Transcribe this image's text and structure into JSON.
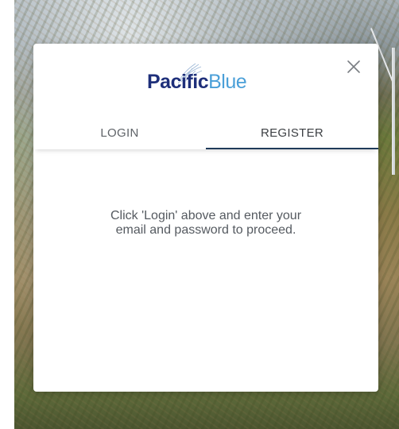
{
  "brand": {
    "name_part1": "Pacific",
    "name_part2": "Blue",
    "colors": {
      "primary": "#1e2f7a",
      "secondary": "#4a9fd8",
      "tab_underline": "#1f3b5a"
    }
  },
  "modal": {
    "close_icon": "close-icon",
    "tabs": [
      {
        "label": "LOGIN",
        "active": false
      },
      {
        "label": "REGISTER",
        "active": true
      }
    ],
    "message_lines": [
      "Click 'Login' above and enter your",
      "email and password to proceed."
    ]
  }
}
